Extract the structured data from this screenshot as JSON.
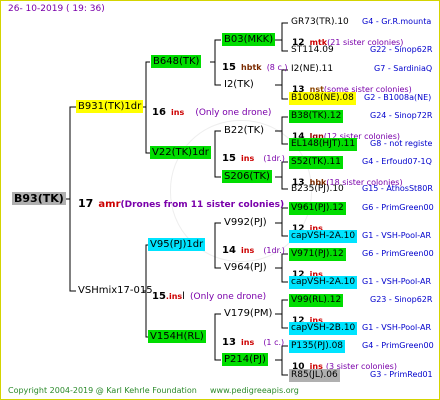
{
  "header": {
    "timestamp": "26- 10-2019 ( 19: 36)"
  },
  "footer": {
    "copyright": "Copyright 2004-2019 @ Karl Kehrle Foundation",
    "url": "www.pedigreeapis.org"
  },
  "root": {
    "name": "B93(TK)",
    "count": "17",
    "class": "amr",
    "note": "(Drones from 11 sister colonies)",
    "color": "#b0b0b0"
  },
  "gen1": [
    {
      "name": "B931(TK)1dr",
      "count": "16",
      "class": "ins",
      "note": "(Only one drone)",
      "color": "#ffff00"
    },
    {
      "name": "VSHmix17-015",
      "count": "15",
      "class": ".ins",
      "class2": "l",
      "note": "(Only one drone)"
    }
  ],
  "gen2": [
    {
      "name": "B648(TK)",
      "count": "15",
      "class": "hbtk",
      "note": "(8 c.)",
      "color": "#00dd00"
    },
    {
      "name": "V22(TK)1dr",
      "count": "15",
      "class": "ins",
      "note": "(1dr.)",
      "color": "#00dd00"
    },
    {
      "name": "V95(PJ)1dr",
      "count": "14",
      "class": "ins",
      "note": "(1dr.)",
      "color": "#00e4ff"
    },
    {
      "name": "V154H(RL)",
      "count": "13",
      "class": "ins",
      "note": "(1 c.)",
      "color": "#00dd00"
    }
  ],
  "gen3": [
    {
      "name": "B03(MKK)",
      "color": "#00dd00"
    },
    {
      "name": "I2(TK)"
    },
    {
      "name": "B22(TK)"
    },
    {
      "name": "S206(TK)",
      "color": "#00dd00"
    },
    {
      "name": "V992(PJ)"
    },
    {
      "name": "V964(PJ)"
    },
    {
      "name": "V179(PM)"
    },
    {
      "name": "P214(PJ)",
      "color": "#00dd00"
    }
  ],
  "gen4": [
    {
      "name": "GR73(TR).10",
      "info": "G4 - Gr.R.mounta"
    },
    {
      "count": "12",
      "class": "mtk",
      "note": "(21 sister colonies)"
    },
    {
      "name": "ST114.09",
      "info": "G22 - Sinop62R"
    },
    {
      "name": "I2(NE).11",
      "info": "G7 - SardiniaQ"
    },
    {
      "count": "13",
      "class": "nst",
      "note": "(some sister colonies)"
    },
    {
      "name": "B1008(NE).08",
      "info": "G2 - B1008a(NE)",
      "color": "#ffff00"
    },
    {
      "name": "B38(TK).12",
      "info": "G24 - Sinop72R",
      "color": "#00dd00"
    },
    {
      "count": "14",
      "class": "lgn",
      "note": "(12 sister colonies)"
    },
    {
      "name": "EL148(HJT).11",
      "info": "G8 - not registe",
      "color": "#00dd00"
    },
    {
      "name": "S52(TK).11",
      "info": "G4 - Erfoud07-1Q",
      "color": "#00dd00"
    },
    {
      "count": "13",
      "class": "hbk",
      "note": "(18 sister colonies)"
    },
    {
      "name": "B235(PJ).10",
      "info": "G15 - AthosSt80R"
    },
    {
      "name": "V961(PJ).12",
      "info": "G6 - PrimGreen00",
      "color": "#00dd00"
    },
    {
      "count": "12",
      "class": "ins",
      "note": ""
    },
    {
      "name": "capVSH-2A.10",
      "info": "G1 - VSH-Pool-AR",
      "color": "#00e4ff"
    },
    {
      "name": "V971(PJ).12",
      "info": "G6 - PrimGreen00",
      "color": "#00dd00"
    },
    {
      "count": "12",
      "class": "ins",
      "note": ""
    },
    {
      "name": "capVSH-2A.10",
      "info": "G1 - VSH-Pool-AR",
      "color": "#00e4ff"
    },
    {
      "name": "V99(RL).12",
      "info": "G23 - Sinop62R",
      "color": "#00dd00"
    },
    {
      "count": "12",
      "class": "ins",
      "note": ""
    },
    {
      "name": "capVSH-2B.10",
      "info": "G1 - VSH-Pool-AR",
      "color": "#00e4ff"
    },
    {
      "name": "P135(PJ).08",
      "info": "G4 - PrimGreen00",
      "color": "#00e4ff"
    },
    {
      "count": "10",
      "class": "ins",
      "note": "(3 sister colonies)"
    },
    {
      "name": "R85(JL).06",
      "info": "G3 - PrimRed01",
      "color": "#b0b0b0"
    }
  ]
}
